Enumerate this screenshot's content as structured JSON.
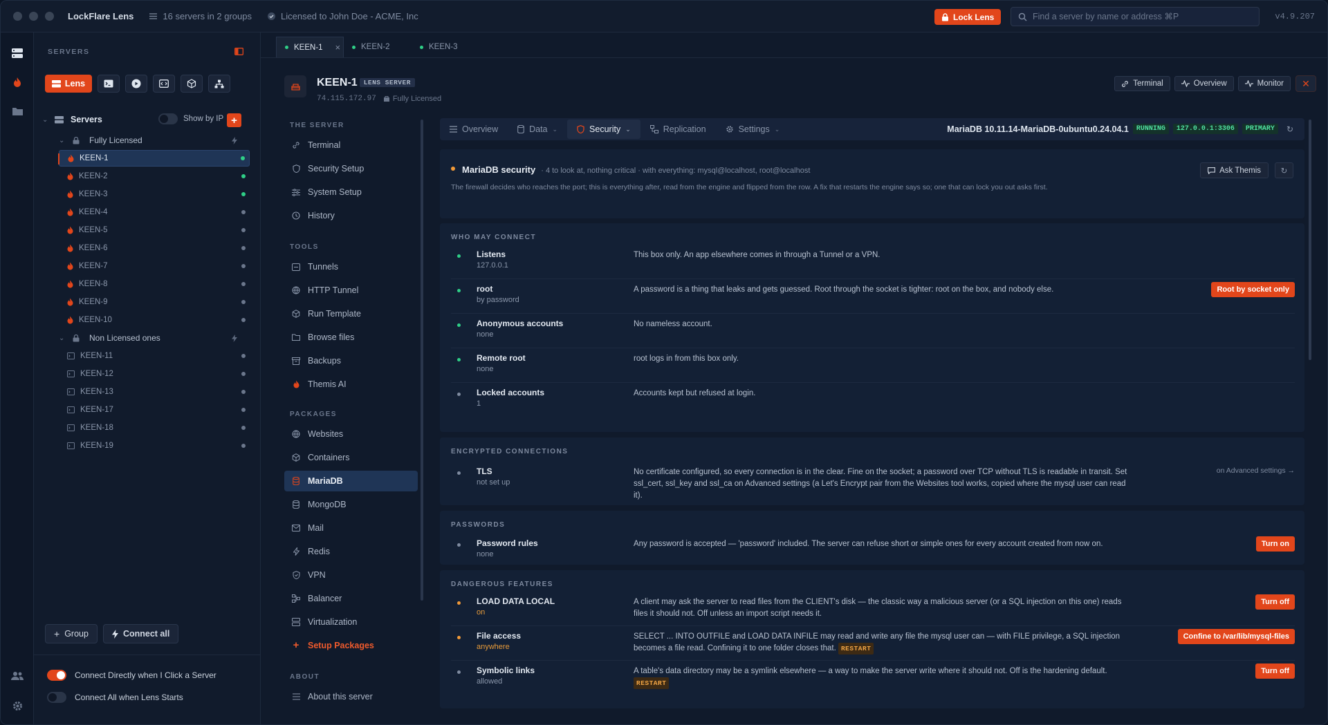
{
  "app": {
    "title": "LockFlare Lens",
    "servers_meta": "16 servers in 2 groups",
    "license_meta": "Licensed to John Doe - ACME, Inc",
    "lock_label": "Lock Lens",
    "search_placeholder": "Find a server by name or address ⌘P",
    "version": "v4.9.207"
  },
  "sidebar": {
    "section_label": "SERVERS",
    "lens_label": "Lens",
    "tree_root": "Servers",
    "show_by_ip": "Show by IP",
    "groups": [
      {
        "name": "Fully Licensed",
        "servers": [
          {
            "name": "KEEN-1",
            "online": true,
            "selected": true
          },
          {
            "name": "KEEN-2",
            "online": true
          },
          {
            "name": "KEEN-3",
            "online": true
          },
          {
            "name": "KEEN-4",
            "online": false
          },
          {
            "name": "KEEN-5",
            "online": false
          },
          {
            "name": "KEEN-6",
            "online": false
          },
          {
            "name": "KEEN-7",
            "online": false
          },
          {
            "name": "KEEN-8",
            "online": false
          },
          {
            "name": "KEEN-9",
            "online": false
          },
          {
            "name": "KEEN-10",
            "online": false
          }
        ]
      },
      {
        "name": "Non Licensed ones",
        "servers": [
          {
            "name": "KEEN-11",
            "online": false
          },
          {
            "name": "KEEN-12",
            "online": false
          },
          {
            "name": "KEEN-13",
            "online": false
          },
          {
            "name": "KEEN-17",
            "online": false
          },
          {
            "name": "KEEN-18",
            "online": false
          },
          {
            "name": "KEEN-19",
            "online": false
          }
        ]
      }
    ],
    "group_btn": "Group",
    "connect_all_btn": "Connect all",
    "opt1": "Connect Directly when I Click a Server",
    "opt2": "Connect All when Lens Starts",
    "opt1_on": true,
    "opt2_on": false
  },
  "tabs": [
    "KEEN-1",
    "KEEN-2",
    "KEEN-3"
  ],
  "server": {
    "name": "KEEN-1",
    "badge": "LENS SERVER",
    "ip": "74.115.172.97",
    "license": "Fully Licensed"
  },
  "header_btns": {
    "terminal": "Terminal",
    "overview": "Overview",
    "monitor": "Monitor"
  },
  "subnav": {
    "sec1": "THE SERVER",
    "s1": [
      "Terminal",
      "Security Setup",
      "System Setup",
      "History"
    ],
    "sec2": "TOOLS",
    "s2": [
      "Tunnels",
      "HTTP Tunnel",
      "Run Template",
      "Browse files",
      "Backups",
      "Themis AI"
    ],
    "sec3": "PACKAGES",
    "s3": [
      "Websites",
      "Containers",
      "MariaDB",
      "MongoDB",
      "Mail",
      "Redis",
      "VPN",
      "Balancer",
      "Virtualization",
      "Setup Packages"
    ],
    "sec4": "ABOUT",
    "s4": [
      "About this server"
    ]
  },
  "content_tabs": [
    "Overview",
    "Data",
    "Security",
    "Replication",
    "Settings"
  ],
  "version_info": {
    "text": "MariaDB 10.11.14-MariaDB-0ubuntu0.24.04.1",
    "status": "RUNNING",
    "addr": "127.0.0.1:3306",
    "role": "PRIMARY"
  },
  "security": {
    "title": "MariaDB security",
    "summary": "· 4 to look at, nothing critical · with everything: mysql@localhost, root@localhost",
    "description": "The firewall decides who reaches the port; this is everything after, read from the engine and flipped from the row. A fix that restarts the engine says so; one that can lock you out asks first.",
    "ask_btn": "Ask Themis"
  },
  "sections": {
    "who": {
      "title": "WHO MAY CONNECT",
      "rows": [
        {
          "key": "Listens",
          "value": "127.0.0.1",
          "desc": "This box only. An app elsewhere comes in through a Tunnel or a VPN."
        },
        {
          "key": "root",
          "value": "by password",
          "desc": "A password is a thing that leaks and gets guessed. Root through the socket is tighter: root on the box, and nobody else.",
          "action": "Root by socket only"
        },
        {
          "key": "Anonymous accounts",
          "value": "none",
          "desc": "No nameless account."
        },
        {
          "key": "Remote root",
          "value": "none",
          "desc": "root logs in from this box only."
        },
        {
          "key": "Locked accounts",
          "value": "1",
          "desc": "Accounts kept but refused at login."
        }
      ]
    },
    "enc": {
      "title": "ENCRYPTED CONNECTIONS",
      "rows": [
        {
          "key": "TLS",
          "value": "not set up",
          "desc": "No certificate configured, so every connection is in the clear. Fine on the socket; a password over TCP without TLS is readable in transit. Set ssl_cert, ssl_key and ssl_ca on Advanced settings (a Let's Encrypt pair from the Websites tool works, copied where the mysql user can read it).",
          "link": "on Advanced settings →"
        }
      ]
    },
    "pw": {
      "title": "PASSWORDS",
      "rows": [
        {
          "key": "Password rules",
          "value": "none",
          "desc": "Any password is accepted — 'password' included. The server can refuse short or simple ones for every account created from now on.",
          "action": "Turn on"
        }
      ]
    },
    "danger": {
      "title": "DANGEROUS FEATURES",
      "rows": [
        {
          "key": "LOAD DATA LOCAL",
          "value": "on",
          "desc": "A client may ask the server to read files from the CLIENT's disk — the classic way a malicious server (or a SQL injection on this one) reads files it should not. Off unless an import script needs it.",
          "action": "Turn off"
        },
        {
          "key": "File access",
          "value": "anywhere",
          "desc": "SELECT ... INTO OUTFILE and LOAD DATA INFILE may read and write any file the mysql user can — with FILE privilege, a SQL injection becomes a file read. Confining it to one folder closes that.",
          "tag": "RESTART",
          "action": "Confine to /var/lib/mysql-files"
        },
        {
          "key": "Symbolic links",
          "value": "allowed",
          "desc": "A table's data directory may be a symlink elsewhere — a way to make the server write where it should not. Off is the hardening default.",
          "tag": "RESTART",
          "action": "Turn off"
        }
      ]
    }
  }
}
